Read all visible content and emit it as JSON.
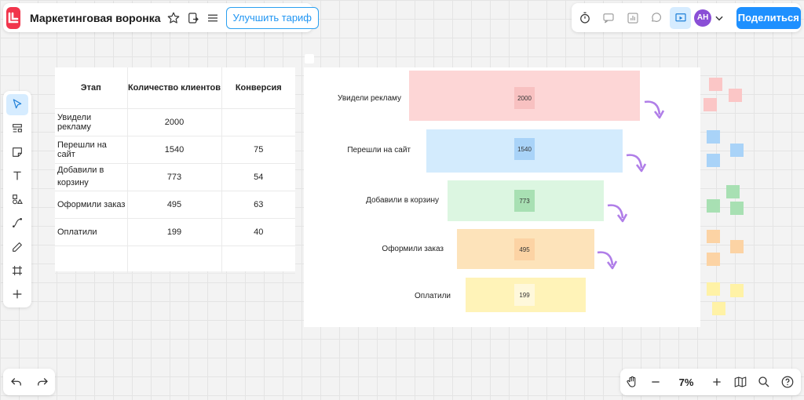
{
  "app": {
    "board_title": "Маркетинговая воронка",
    "upgrade_label": "Улучшить тариф",
    "share_label": "Поделиться",
    "avatar_initials": "АН",
    "zoom_level": "7%"
  },
  "colors": {
    "brand": "#f1354c",
    "accent": "#1e90ff",
    "avatar": "#8a4fd6",
    "arrow": "#b07ee8"
  },
  "toolbar_icons": [
    "select-icon",
    "templates-icon",
    "sticky-note-icon",
    "text-icon",
    "shapes-icon",
    "connector-icon",
    "pen-icon",
    "frame-icon",
    "add-icon"
  ],
  "table": {
    "headers": [
      "Этап",
      "Количество клиентов",
      "Конверсия"
    ],
    "rows": [
      [
        "Увидели рекламу",
        "2000",
        ""
      ],
      [
        "Перешли на сайт",
        "1540",
        "75"
      ],
      [
        "Добавили в корзину",
        "773",
        "54"
      ],
      [
        "Оформили заказ",
        "495",
        "63"
      ],
      [
        "Оплатили",
        "199",
        "40"
      ],
      [
        "",
        "",
        ""
      ]
    ]
  },
  "funnel": {
    "stages": [
      {
        "label": "Увидели рекламу",
        "value": "2000",
        "bar_color": "#fdd6d6",
        "note_color": "#f8c1c1"
      },
      {
        "label": "Перешли на сайт",
        "value": "1540",
        "bar_color": "#d3ebfd",
        "note_color": "#a9d3f8"
      },
      {
        "label": "Добавили в корзину",
        "value": "773",
        "bar_color": "#dcf6e1",
        "note_color": "#a8e0b3"
      },
      {
        "label": "Оформили заказ",
        "value": "495",
        "bar_color": "#fde3ba",
        "note_color": "#fcd3a4"
      },
      {
        "label": "Оплатили",
        "value": "199",
        "bar_color": "#fff3b8",
        "note_color": "#fff8db"
      }
    ]
  },
  "swatches": {
    "colors": [
      "#fbc6c6",
      "#a9d3f8",
      "#a8e0b3",
      "#fcd3a4",
      "#fff2a6"
    ]
  }
}
